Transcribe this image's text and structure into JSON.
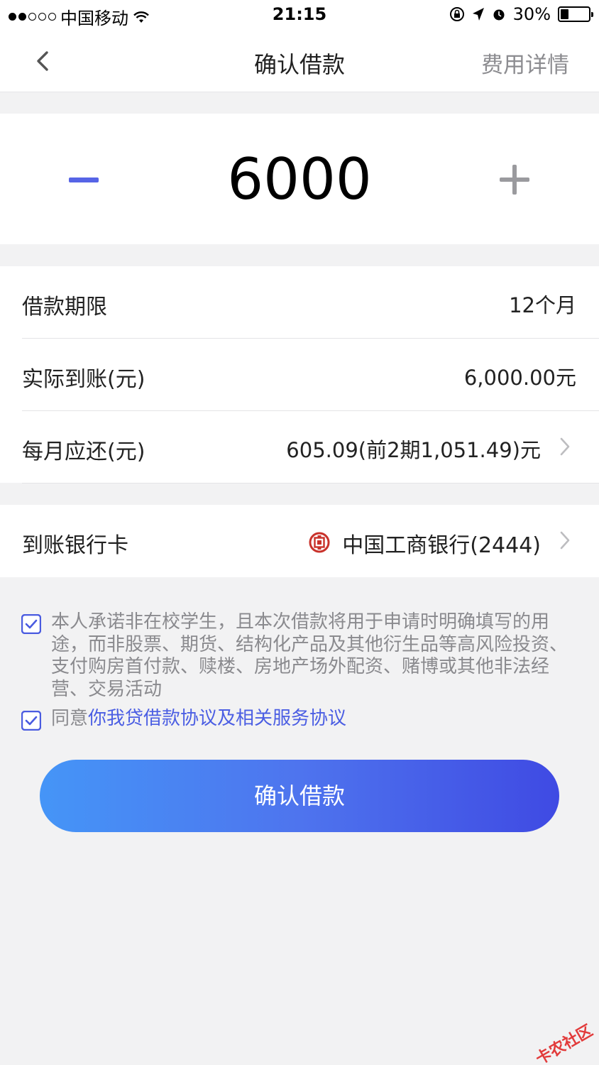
{
  "status_bar": {
    "carrier": "中国移动",
    "time": "21:15",
    "battery": "30%",
    "battery_level": 0.3
  },
  "nav": {
    "title": "确认借款",
    "detail_link": "费用详情"
  },
  "amount": {
    "value": "6000"
  },
  "info": {
    "term_label": "借款期限",
    "term_value": "12个月",
    "received_label": "实际到账(元)",
    "received_value": "6,000.00元",
    "monthly_label": "每月应还(元)",
    "monthly_value": "605.09(前2期1,051.49)元"
  },
  "bank": {
    "label": "到账银行卡",
    "value": "中国工商银行(2444)"
  },
  "agreements": {
    "promise_text": "本人承诺非在校学生，且本次借款将用于申请时明确填写的用途，而非股票、期货、结构化产品及其他衍生品等高风险投资、支付购房首付款、赎楼、房地产场外配资、赌博或其他非法经营、交易活动",
    "agree_prefix": "同意",
    "agree_link": "你我贷借款协议及相关服务协议"
  },
  "confirm_button": "确认借款",
  "watermark": "卡农社区",
  "colors": {
    "accent": "#4b5ee3",
    "button_start": "#4595f7",
    "button_end": "#3f4ae3",
    "icbc_red": "#c9322b"
  }
}
